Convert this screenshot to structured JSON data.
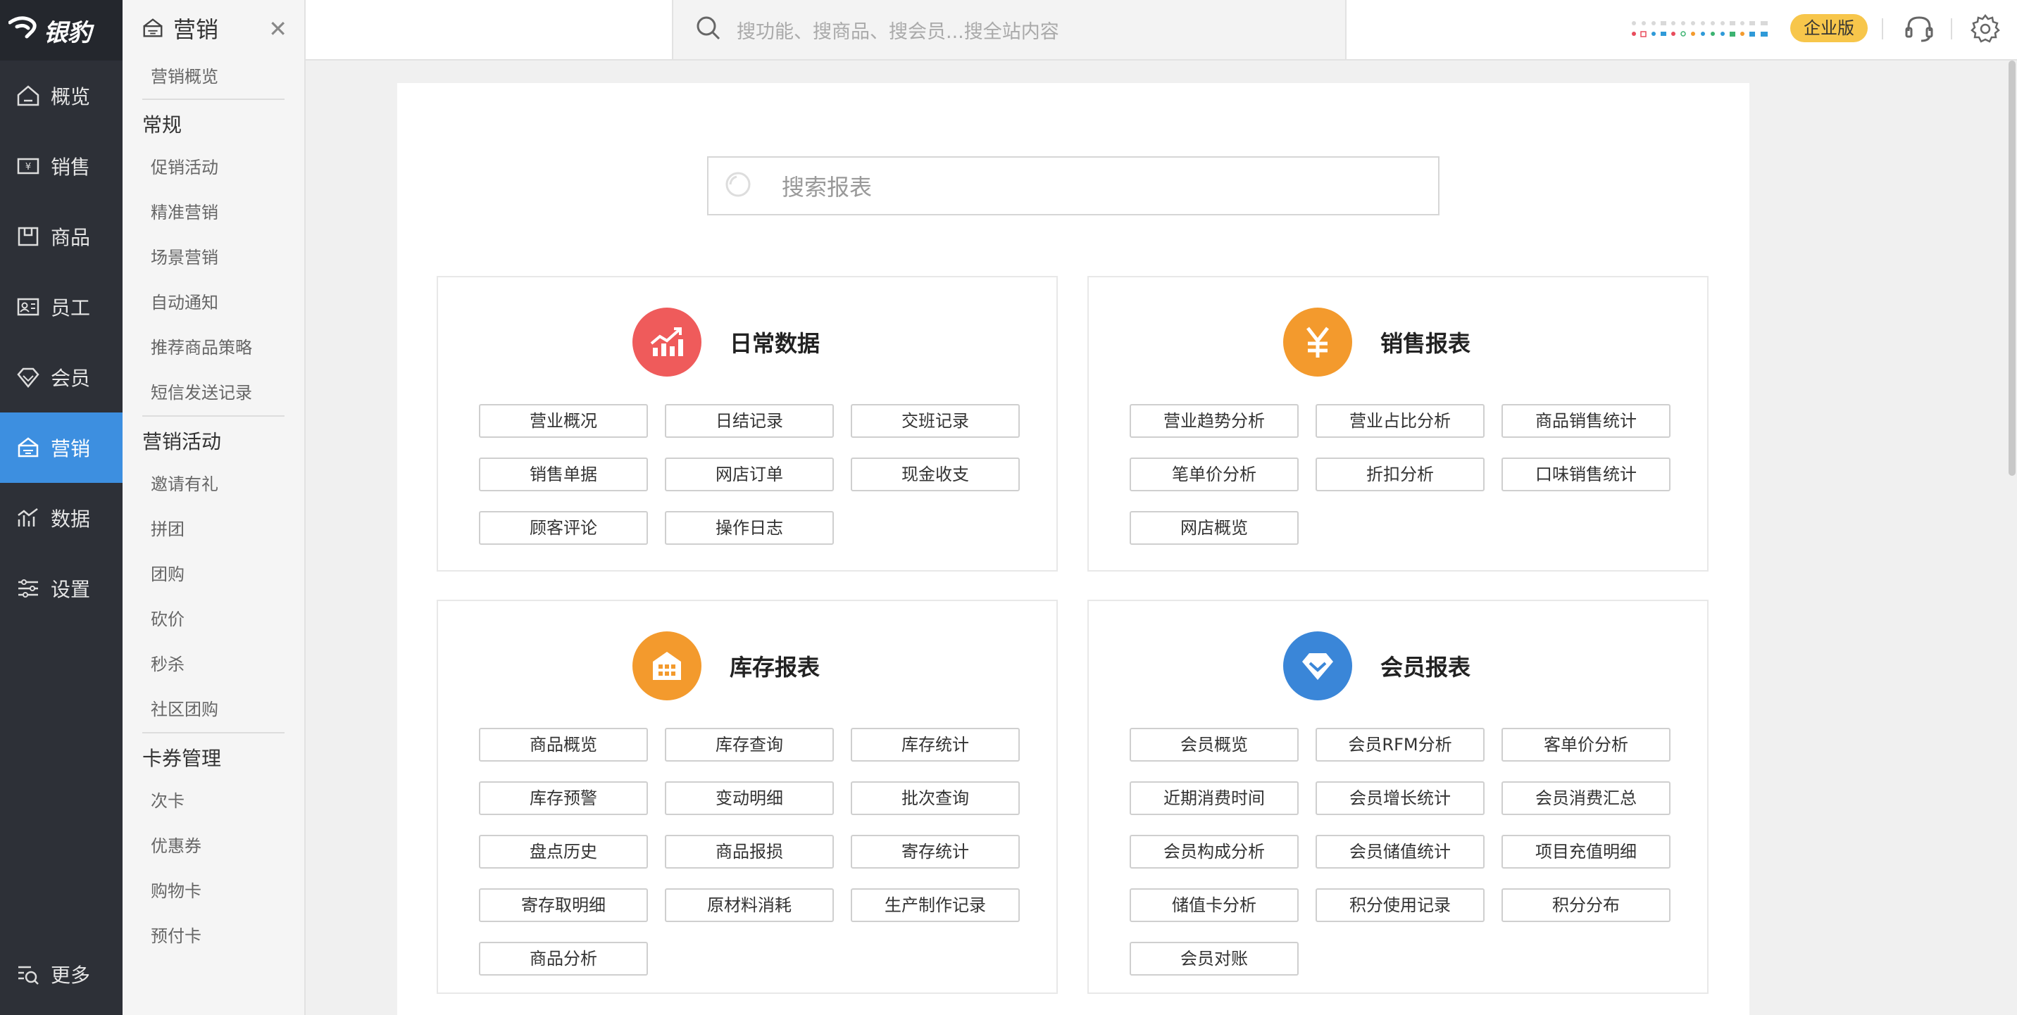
{
  "brand": {
    "name": "银豹",
    "mark": "✦"
  },
  "nav": {
    "items": [
      {
        "label": "概览",
        "icon": "home-icon"
      },
      {
        "label": "销售",
        "icon": "sales-icon"
      },
      {
        "label": "商品",
        "icon": "box-icon"
      },
      {
        "label": "员工",
        "icon": "id-card-icon"
      },
      {
        "label": "会员",
        "icon": "diamond-icon"
      },
      {
        "label": "营销",
        "icon": "marketing-icon"
      },
      {
        "label": "数据",
        "icon": "chart-icon"
      },
      {
        "label": "设置",
        "icon": "sliders-icon"
      }
    ],
    "active_index": 5,
    "more_label": "更多"
  },
  "subnav": {
    "title": "营销",
    "close_symbol": "✕",
    "overview": "营销概览",
    "groups": [
      {
        "title": "常规",
        "items": [
          "促销活动",
          "精准营销",
          "场景营销",
          "自动通知",
          "推荐商品策略",
          "短信发送记录"
        ]
      },
      {
        "title": "营销活动",
        "items": [
          "邀请有礼",
          "拼团",
          "团购",
          "砍价",
          "秒杀",
          "社区团购"
        ]
      },
      {
        "title": "卡券管理",
        "items": [
          "次卡",
          "优惠券",
          "购物卡",
          "预付卡"
        ]
      }
    ]
  },
  "topbar": {
    "search_placeholder": "搜功能、搜商品、搜会员...搜全站内容",
    "edition_badge": "企业版"
  },
  "main": {
    "report_search_placeholder": "搜索报表",
    "panels": [
      {
        "title": "日常数据",
        "icon": "trend-chart-icon",
        "color": "#ef5b5b",
        "buttons": [
          "营业概况",
          "日结记录",
          "交班记录",
          "销售单据",
          "网店订单",
          "现金收支",
          "顾客评论",
          "操作日志"
        ]
      },
      {
        "title": "销售报表",
        "icon": "yen-icon",
        "color": "#f39a2d",
        "buttons": [
          "营业趋势分析",
          "营业占比分析",
          "商品销售统计",
          "笔单价分析",
          "折扣分析",
          "口味销售统计",
          "网店概览"
        ]
      },
      {
        "title": "库存报表",
        "icon": "warehouse-icon",
        "color": "#f39a2d",
        "buttons": [
          "商品概览",
          "库存查询",
          "库存统计",
          "库存预警",
          "变动明细",
          "批次查询",
          "盘点历史",
          "商品报损",
          "寄存统计",
          "寄存取明细",
          "原材料消耗",
          "生产制作记录",
          "商品分析"
        ]
      },
      {
        "title": "会员报表",
        "icon": "diamond-icon",
        "color": "#3a86d8",
        "buttons": [
          "会员概览",
          "会员RFM分析",
          "客单价分析",
          "近期消费时间",
          "会员增长统计",
          "会员消费汇总",
          "会员构成分析",
          "会员储值统计",
          "项目充值明细",
          "储值卡分析",
          "积分使用记录",
          "积分分布",
          "会员对账"
        ]
      }
    ]
  }
}
